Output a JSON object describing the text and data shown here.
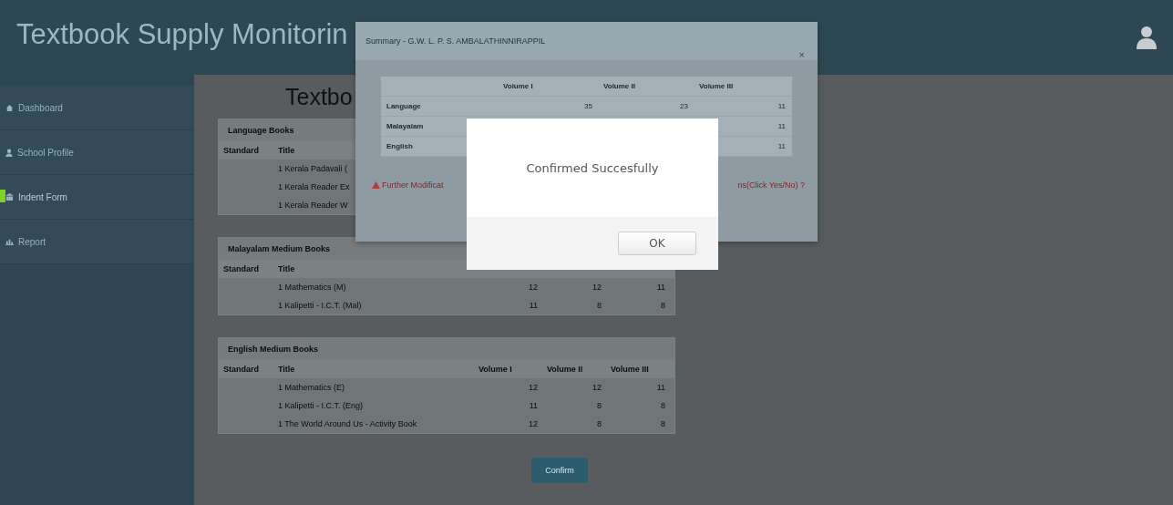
{
  "header": {
    "title": "Textbook Supply Monitorin"
  },
  "sidebar": {
    "items": [
      {
        "label": "Dashboard",
        "selected": false
      },
      {
        "label": "School Profile",
        "selected": false
      },
      {
        "label": "Indent Form",
        "selected": true
      },
      {
        "label": "Report",
        "selected": false
      }
    ]
  },
  "page": {
    "title": "Textbo",
    "sections": [
      {
        "title": "Language Books",
        "columns": [
          "Standard",
          "Title"
        ],
        "rows": [
          {
            "title": "1 Kerala Padavali (",
            "volumes": []
          },
          {
            "title": "1 Kerala Reader Ex",
            "volumes": []
          },
          {
            "title": "1 Kerala Reader W",
            "volumes": []
          }
        ]
      },
      {
        "title": "Malayalam Medium Books",
        "columns": [
          "Standard",
          "Title"
        ],
        "rows": [
          {
            "title": "1 Mathematics (M)",
            "volumes": [
              "12",
              "12",
              "11"
            ]
          },
          {
            "title": "1 Kalipetti - I.C.T. (Mal)",
            "volumes": [
              "11",
              "8",
              "8"
            ]
          }
        ]
      },
      {
        "title": "English Medium Books",
        "columns": [
          "Standard",
          "Title",
          "Volume I",
          "Volume II",
          "Volume III"
        ],
        "rows": [
          {
            "title": "1 Mathematics (E)",
            "volumes": [
              "12",
              "12",
              "11"
            ]
          },
          {
            "title": "1 Kalipetti - I.C.T. (Eng)",
            "volumes": [
              "11",
              "8",
              "8"
            ]
          },
          {
            "title": "1 The World Around Us - Activity Book",
            "volumes": [
              "12",
              "8",
              "8"
            ]
          }
        ]
      }
    ],
    "confirm_button": "Confirm"
  },
  "summary_modal": {
    "title": "Summary - G.W. L. P. S. AMBALATHINNIRAPPIL",
    "close": "×",
    "columns": [
      "Volume I",
      "Volume II",
      "Volume III"
    ],
    "rows": [
      {
        "label": "Language",
        "volume_i": "35",
        "volume_ii": "23",
        "volume_iii": "11"
      },
      {
        "label": "Malayalam",
        "volume_iii": "11"
      },
      {
        "label": "English",
        "volume_iii": "11"
      }
    ],
    "warning_start": "Further Modificat",
    "warning_end": "ns(Click Yes/No) ?"
  },
  "alert": {
    "message": "Confirmed Succesfully",
    "button": "OK"
  }
}
